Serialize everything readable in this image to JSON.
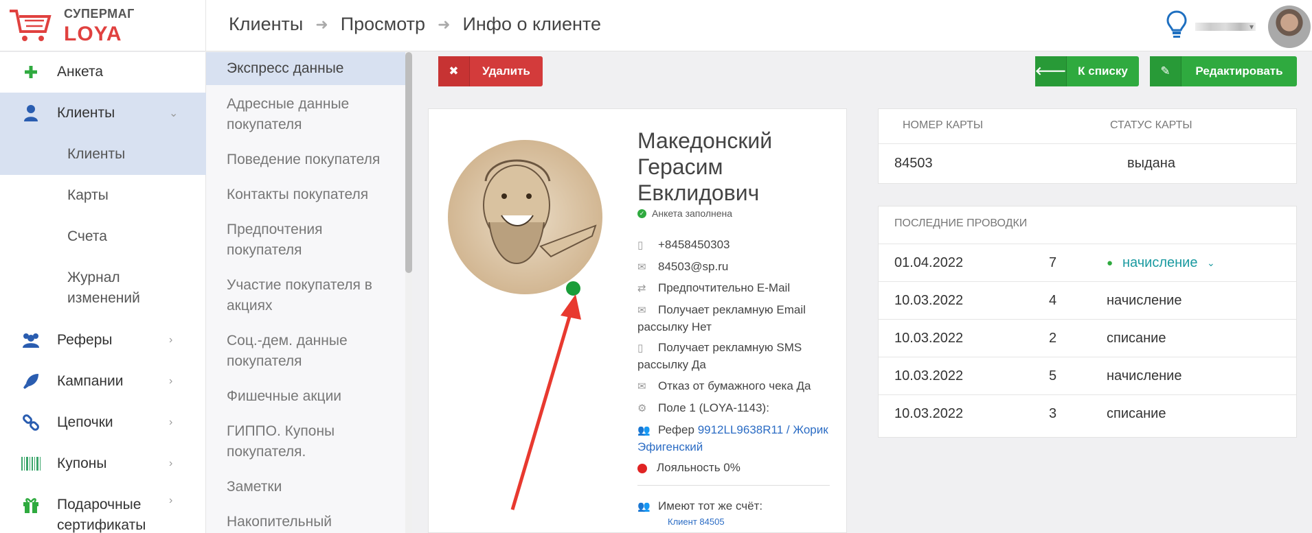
{
  "brand": {
    "line1": "СУПЕРМАГ",
    "line2": "LOYA"
  },
  "breadcrumb": [
    "Клиенты",
    "Просмотр",
    "Инфо о клиенте"
  ],
  "sidebar": {
    "items": [
      {
        "label": "Анкета",
        "icon": "plus-icon"
      },
      {
        "label": "Клиенты",
        "icon": "user-icon"
      },
      {
        "label": "Клиенты"
      },
      {
        "label": "Карты"
      },
      {
        "label": "Счета"
      },
      {
        "label": "Журнал изменений"
      },
      {
        "label": "Реферы",
        "icon": "users-icon"
      },
      {
        "label": "Кампании",
        "icon": "rocket-icon"
      },
      {
        "label": "Цепочки",
        "icon": "chain-icon"
      },
      {
        "label": "Купоны",
        "icon": "barcode-icon"
      },
      {
        "label": "Подарочные сертификаты",
        "icon": "gift-icon"
      }
    ]
  },
  "subnav": [
    "Экспресс данные",
    "Адресные данные покупателя",
    "Поведение покупателя",
    "Контакты покупателя",
    "Предпочтения покупателя",
    "Участие покупателя в акциях",
    "Соц.-дем. данные покупателя",
    "Фишечные акции",
    "ГИППО. Купоны покупателя.",
    "Заметки",
    "Накопительный"
  ],
  "buttons": {
    "delete": "Удалить",
    "to_list": "К списку",
    "edit": "Редактировать"
  },
  "profile": {
    "name": "Македонский Герасим Евклидович",
    "status": "Анкета заполнена",
    "phone": "+8458450303",
    "email": "84503@sp.ru",
    "pref": "Предпочтительно E-Mail",
    "email_ads": "Получает рекламную Email рассылку Нет",
    "sms_ads": "Получает рекламную SMS рассылку Да",
    "paper": "Отказ от бумажного чека Да",
    "field1": "Поле 1 (LOYA-1143):",
    "ref_label": "Рефер",
    "ref_link": "9912LL9638R11 / Жорик Эфигенский",
    "loyalty": "Лояльность 0%",
    "same_account": "Имеют тот же счёт:",
    "same_client": "Клиент 84505"
  },
  "card_info": {
    "col1": "НОМЕР КАРТЫ",
    "col2": "СТАТУС КАРТЫ",
    "number": "84503",
    "status": "выдана"
  },
  "transactions": {
    "title": "ПОСЛЕДНИЕ ПРОВОДКИ",
    "rows": [
      {
        "date": "01.04.2022",
        "amount": "7",
        "type": "начисление"
      },
      {
        "date": "10.03.2022",
        "amount": "4",
        "type": "начисление"
      },
      {
        "date": "10.03.2022",
        "amount": "2",
        "type": "списание"
      },
      {
        "date": "10.03.2022",
        "amount": "5",
        "type": "начисление"
      },
      {
        "date": "10.03.2022",
        "amount": "3",
        "type": "списание"
      }
    ]
  },
  "colors": {
    "brand_red": "#e0413f",
    "green": "#2faa3f",
    "red_button": "#d33b3b",
    "link": "#2b6cc4",
    "arrow": "#e8392f"
  }
}
